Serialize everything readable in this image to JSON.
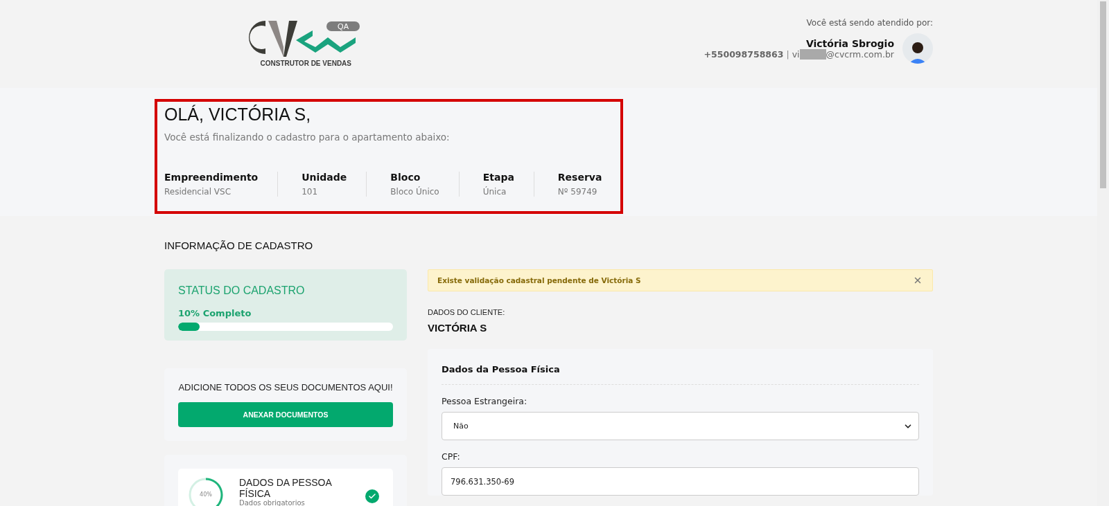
{
  "header": {
    "logo": {
      "badge": "QA",
      "tagline": "CONSTRUTOR DE VENDAS"
    },
    "attendant": {
      "caption": "Você está sendo atendido por:",
      "name": "Victória Sbrogio",
      "phone": "+550098758863",
      "separator": "|",
      "email_start": "vi",
      "email_end": "@cvcrm.com.br"
    }
  },
  "summary": {
    "highlighted": true,
    "greeting": "OLÁ, VICTÓRIA S,",
    "subtitle": "Você está finalizando o cadastro para o apartamento abaixo:",
    "fields": [
      {
        "label": "Empreendimento",
        "value": "Residencial VSC"
      },
      {
        "label": "Unidade",
        "value": "101"
      },
      {
        "label": "Bloco",
        "value": "Bloco Único"
      },
      {
        "label": "Etapa",
        "value": "Única"
      },
      {
        "label": "Reserva",
        "value": "Nº 59749"
      }
    ]
  },
  "section_title": "INFORMAÇÃO DE CADASTRO",
  "status": {
    "title": "STATUS DO CADASTRO",
    "caption": "10% Completo",
    "level": 0.1
  },
  "documents": {
    "title": "ADICIONE TODOS OS SEUS DOCUMENTOS AQUI!",
    "button": "ANEXAR DOCUMENTOS"
  },
  "steps": [
    {
      "title": "DADOS DA PESSOA FÍSICA",
      "subtitle": "Dados obrigatorios",
      "ring_label": "40%",
      "level": 0.4,
      "done": true
    }
  ],
  "alert": {
    "text": "Existe validação cadastral pendente de Victória S"
  },
  "client": {
    "caption": "DADOS DO CLIENTE:",
    "name": "VICTÓRIA S"
  },
  "form": {
    "title": "Dados da Pessoa Física",
    "fields": [
      {
        "kind": "select",
        "label": "Pessoa Estrangeira:",
        "value": "Não"
      },
      {
        "kind": "input",
        "label": "CPF:",
        "value": "796.631.350-69"
      }
    ]
  }
}
